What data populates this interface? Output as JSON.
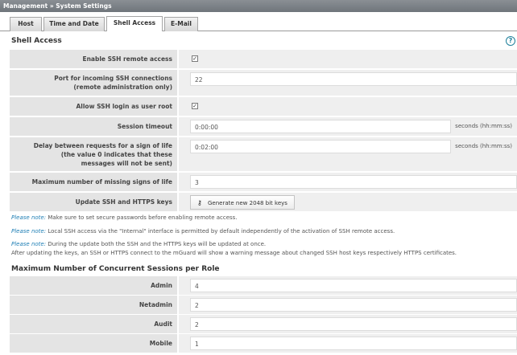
{
  "breadcrumb": "Management » System Settings",
  "tabs": [
    {
      "label": "Host"
    },
    {
      "label": "Time and Date"
    },
    {
      "label": "Shell Access"
    },
    {
      "label": "E-Mail"
    }
  ],
  "shell": {
    "title": "Shell Access",
    "ssh_enable_label": "Enable SSH remote access",
    "ssh_enable_checked": true,
    "port_label": "Port for incoming SSH connections (remote administration only)",
    "port_value": "22",
    "root_label": "Allow SSH login as user root",
    "root_checked": true,
    "timeout_label": "Session timeout",
    "timeout_value": "0:00:00",
    "timeout_unit": "seconds (hh:mm:ss)",
    "delay_label": "Delay between requests for a sign of life (the value 0 indicates that these messages will not be sent)",
    "delay_value": "0:02:00",
    "delay_unit": "seconds (hh:mm:ss)",
    "missing_label": "Maximum number of missing signs of life",
    "missing_value": "3",
    "update_label": "Update SSH and HTTPS keys",
    "generate_button": "Generate new 2048 bit keys"
  },
  "notes": {
    "label": "Please note:",
    "note1": "Make sure to set secure passwords before enabling remote access.",
    "note2": "Local SSH access via the \"Internal\" interface is permitted by default independently of the activation of SSH remote access.",
    "note3": "During the update both the SSH and the HTTPS keys will be updated at once.",
    "note3b": "After updating the keys, an SSH or HTTPS connect to the mGuard will show a warning message about changed SSH host keys respectively HTTPS certificates."
  },
  "sessions": {
    "title": "Maximum Number of Concurrent Sessions per Role",
    "rows": [
      {
        "label": "Admin",
        "value": "4"
      },
      {
        "label": "Netadmin",
        "value": "2"
      },
      {
        "label": "Audit",
        "value": "2"
      },
      {
        "label": "Mobile",
        "value": "1"
      }
    ]
  }
}
